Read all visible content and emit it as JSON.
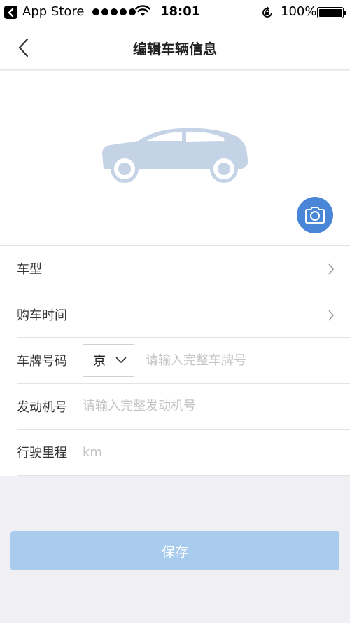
{
  "status_bar": {
    "app_name": "App Store",
    "time": "18:01",
    "battery": "100%"
  },
  "nav": {
    "title": "编辑车辆信息"
  },
  "form": {
    "car_model_label": "车型",
    "purchase_time_label": "购车时间",
    "plate_label": "车牌号码",
    "plate_province": "京",
    "plate_placeholder": "请输入完整车牌号",
    "engine_label": "发动机号",
    "engine_placeholder": "请输入完整发动机号",
    "mileage_label": "行驶里程",
    "mileage_placeholder": "km"
  },
  "save_label": "保存",
  "colors": {
    "accent": "#4a86d7",
    "button_disabled": "#a9cbee",
    "car_silhouette": "#c5d3e6",
    "background": "#efeff4"
  },
  "icons": {
    "back": "chevron-left-icon",
    "camera": "camera-icon",
    "row_arrow": "chevron-right-icon",
    "dropdown": "chevron-down-icon"
  }
}
